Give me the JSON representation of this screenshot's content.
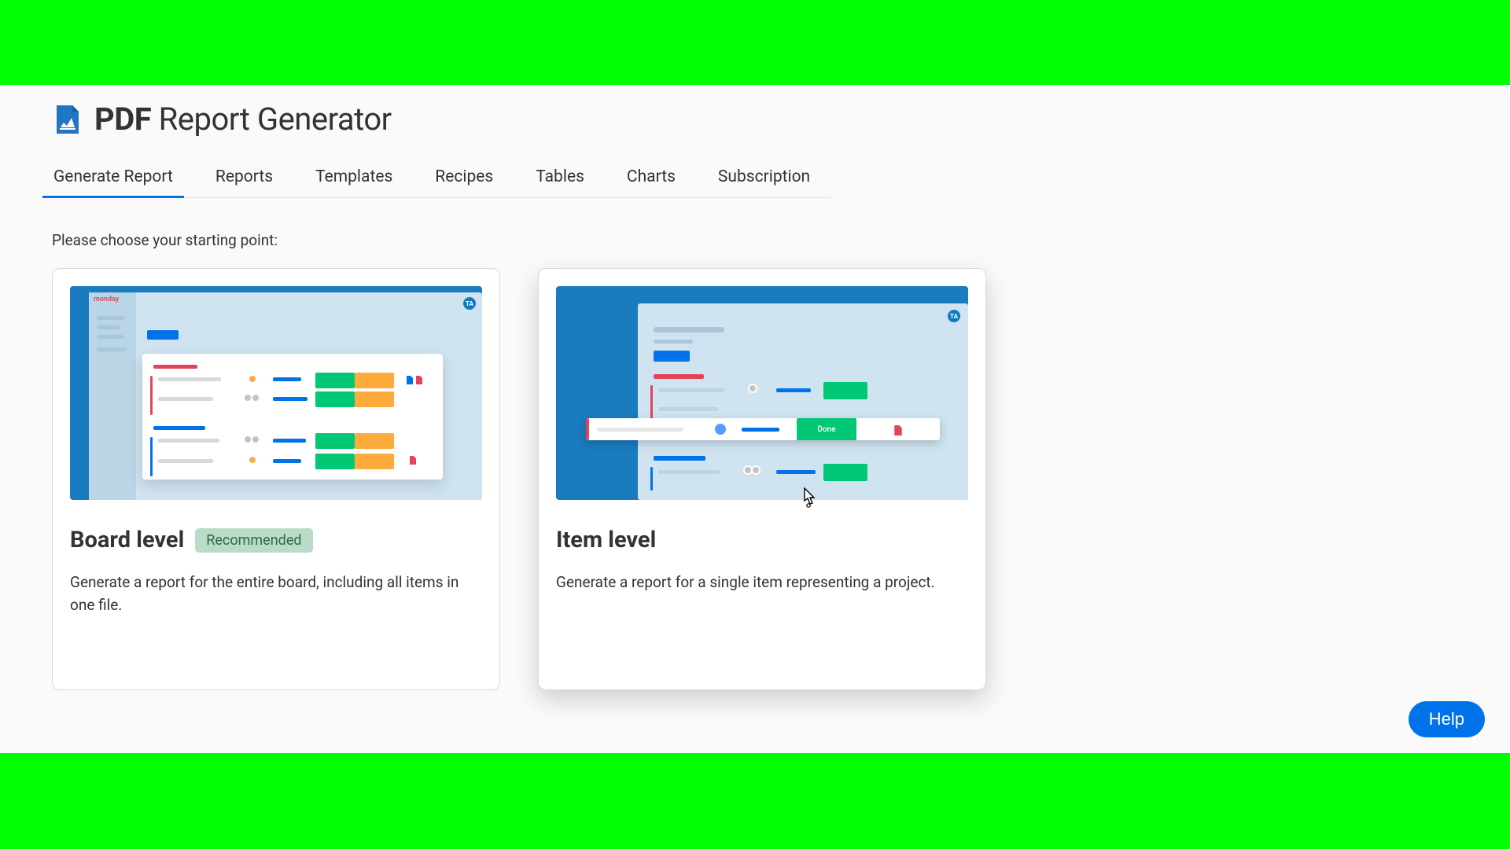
{
  "app": {
    "title_bold": "PDF",
    "title_rest": "Report Generator"
  },
  "tabs": [
    {
      "label": "Generate Report",
      "active": true
    },
    {
      "label": "Reports",
      "active": false
    },
    {
      "label": "Templates",
      "active": false
    },
    {
      "label": "Recipes",
      "active": false
    },
    {
      "label": "Tables",
      "active": false
    },
    {
      "label": "Charts",
      "active": false
    },
    {
      "label": "Subscription",
      "active": false
    }
  ],
  "prompt": "Please choose your starting point:",
  "cards": {
    "board": {
      "title": "Board level",
      "badge": "Recommended",
      "description": "Generate a report for the entire board, including all items in one file.",
      "illus_brand": "monday",
      "illus_badge": "TA"
    },
    "item": {
      "title": "Item level",
      "description": "Generate a report for a single item representing a project.",
      "illus_done": "Done",
      "illus_badge": "TA"
    }
  },
  "help": "Help"
}
